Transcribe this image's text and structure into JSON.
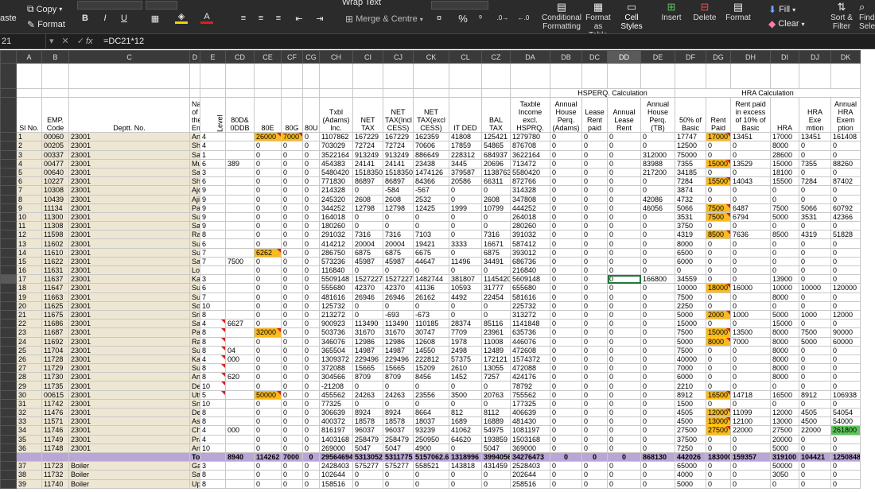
{
  "ribbon": {
    "paste": "aste",
    "copy": "Copy",
    "format_painter": "Format",
    "bold": "B",
    "italic": "I",
    "underline": "U",
    "font_color_letter": "A",
    "wrap_text": "Wrap Text",
    "merge_centre": "Merge & Centre",
    "percent": "%",
    "conditional_formatting": [
      "Conditional",
      "Formatting"
    ],
    "format_as_table": [
      "Format",
      "as Table"
    ],
    "cell_styles": [
      "Cell",
      "Styles"
    ],
    "insert": "Insert",
    "delete": "Delete",
    "format": "Format",
    "fill": "Fill",
    "clear": "Clear",
    "sort_filter": [
      "Sort &",
      "Filter"
    ],
    "find_select": [
      "Find",
      "Sele"
    ],
    "accent_colors": {
      "highlight": "#f0d200",
      "font": "#e81919"
    }
  },
  "formula_bar": {
    "name_box": "21",
    "fx": "fx",
    "formula": "=DC21*12"
  },
  "columns": [
    "A",
    "B",
    "C",
    "D",
    "E",
    "CD",
    "CE",
    "CF",
    "CG",
    "CH",
    "CI",
    "CJ",
    "CK",
    "CL",
    "CZ",
    "DA",
    "DB",
    "DC",
    "DD",
    "DE",
    "DF",
    "DG",
    "DH",
    "DI",
    "DJ",
    "DK"
  ],
  "selected_column": "DD",
  "group_headers": {
    "hsperq": "HSPERQ. Calculation",
    "hra": "HRA Calculation"
  },
  "headers": [
    "Sl No.",
    "EMP. Code",
    "Deptt. No.",
    "Name of the Employee",
    "Level",
    "80D& 0DDB",
    "80E",
    "80G",
    "80U",
    "Txbl (Adams) Inc.",
    "NET TAX",
    "NET TAX(Incl CESS)",
    "NET TAX(excl CESS)",
    "IT DED",
    "BAL TAX",
    "Taxble Income excl. HSPRQ.",
    "Annual House Perq. (Adams)",
    "Lease Rent paid",
    "Annual Lease Rent",
    "Annual House Perq. (TB)",
    "50% of Basic",
    "Rent Paid",
    "Rent paid in excess of 10% of Basic",
    "HRA",
    "HRA Exe mtion",
    "Annual HRA Exem ption"
  ],
  "rows": [
    [
      "1",
      "00060",
      "23001",
      "Anjan Kumar Chowdhury",
      "4",
      "",
      "26000",
      "7000",
      "0",
      "1107862",
      "167229",
      "167229",
      "162359",
      "41808",
      "125421",
      "1279780",
      "0",
      "0",
      "0",
      "0",
      "17747",
      "17000",
      "13451",
      "17000",
      "13451",
      "161408"
    ],
    [
      "2",
      "00205",
      "23001",
      "Shyamal Kumar Patra",
      "4",
      "",
      "0",
      "0",
      "0",
      "703029",
      "72724",
      "72724",
      "70606",
      "17859",
      "54865",
      "876708",
      "0",
      "0",
      "0",
      "0",
      "12500",
      "0",
      "0",
      "8000",
      "0",
      "0"
    ],
    [
      "3",
      "00337",
      "23001",
      "Sabyasachi Mishra",
      "1",
      "",
      "0",
      "0",
      "0",
      "3522164",
      "913249",
      "913249",
      "886649",
      "228312",
      "684937",
      "3622164",
      "0",
      "0",
      "0",
      "312000",
      "75000",
      "0",
      "0",
      "28600",
      "0",
      "0"
    ],
    [
      "4",
      "00477",
      "23001",
      "Mukunda Chandra Mohanta",
      "6",
      "389",
      "0",
      "0",
      "0",
      "454383",
      "24141",
      "24141",
      "23438",
      "3445",
      "20696",
      "713472",
      "0",
      "0",
      "0",
      "83988",
      "7355",
      "15000",
      "13529",
      "15000",
      "7355",
      "88260"
    ],
    [
      "5",
      "00640",
      "23001",
      "Satyabrata Misra",
      "3",
      "",
      "0",
      "0",
      "0",
      "5480420",
      "1518350",
      "1518350",
      "1474126",
      "379587",
      "1138763",
      "5580420",
      "0",
      "0",
      "0",
      "217200",
      "34185",
      "0",
      "0",
      "18100",
      "0",
      "0"
    ],
    [
      "6",
      "10227",
      "23001",
      "Shankar Prasad Kurmy",
      "6",
      "",
      "0",
      "0",
      "0",
      "771830",
      "86897",
      "86897",
      "84366",
      "20586",
      "66311",
      "872766",
      "0",
      "0",
      "0",
      "0",
      "7284",
      "15500",
      "14043",
      "15500",
      "7284",
      "87402"
    ],
    [
      "7",
      "10308",
      "23001",
      "Ajoy Kumar Dutta",
      "9",
      "",
      "0",
      "0",
      "0",
      "214328",
      "0",
      "-584",
      "-567",
      "0",
      "0",
      "314328",
      "0",
      "0",
      "0",
      "0",
      "3874",
      "0",
      "0",
      "0",
      "0",
      "0"
    ],
    [
      "8",
      "10439",
      "23001",
      "Ajit Kumar Basak",
      "9",
      "",
      "0",
      "0",
      "0",
      "245320",
      "2608",
      "2608",
      "2532",
      "0",
      "2608",
      "347808",
      "0",
      "0",
      "0",
      "42086",
      "4732",
      "0",
      "0",
      "0",
      "0",
      "0"
    ],
    [
      "9",
      "11134",
      "23001",
      "Partha Sanyal",
      "9",
      "",
      "0",
      "0",
      "0",
      "344252",
      "12798",
      "12798",
      "12425",
      "1999",
      "10799",
      "444252",
      "0",
      "0",
      "0",
      "46056",
      "5066",
      "7500",
      "6487",
      "7500",
      "5066",
      "60792"
    ],
    [
      "10",
      "11300",
      "23001",
      "Subrata Paul",
      "9",
      "",
      "0",
      "0",
      "0",
      "164018",
      "0",
      "0",
      "0",
      "0",
      "0",
      "264018",
      "0",
      "0",
      "0",
      "0",
      "3531",
      "7500",
      "6794",
      "5000",
      "3531",
      "42366"
    ],
    [
      "11",
      "11308",
      "23001",
      "Santanu Sengupta",
      "9",
      "",
      "0",
      "0",
      "0",
      "180260",
      "0",
      "0",
      "0",
      "0",
      "0",
      "280260",
      "0",
      "0",
      "0",
      "0",
      "3750",
      "0",
      "0",
      "0",
      "0",
      "0"
    ],
    [
      "12",
      "11598",
      "23001",
      "Rajani Kant Mishra",
      "8",
      "",
      "0",
      "0",
      "0",
      "291032",
      "7316",
      "7316",
      "7103",
      "0",
      "7316",
      "391032",
      "0",
      "0",
      "0",
      "0",
      "4319",
      "8500",
      "7636",
      "8500",
      "4319",
      "51828"
    ],
    [
      "13",
      "11602",
      "23001",
      "Surjit Singh",
      "6",
      "",
      "0",
      "0",
      "0",
      "414212",
      "20004",
      "20004",
      "19421",
      "3333",
      "16671",
      "587412",
      "0",
      "0",
      "0",
      "0",
      "8000",
      "0",
      "0",
      "0",
      "0",
      "0"
    ],
    [
      "14",
      "11610",
      "23001",
      "Sudip Kumar Das",
      "7",
      "",
      "6262",
      "0",
      "0",
      "286750",
      "6875",
      "6875",
      "6675",
      "0",
      "6875",
      "393012",
      "0",
      "0",
      "0",
      "0",
      "6500",
      "0",
      "0",
      "0",
      "0",
      "0"
    ],
    [
      "15",
      "11622",
      "23001",
      "Sanjoy Bose",
      "7",
      "7500",
      "0",
      "0",
      "0",
      "573236",
      "45987",
      "45987",
      "44647",
      "11496",
      "34491",
      "686736",
      "0",
      "0",
      "0",
      "0",
      "6000",
      "0",
      "0",
      "0",
      "0",
      "0"
    ],
    [
      "16",
      "11631",
      "23001",
      "Lopamudra Roy",
      "",
      "",
      "0",
      "0",
      "0",
      "116840",
      "0",
      "0",
      "0",
      "0",
      "0",
      "216840",
      "0",
      "0",
      "0",
      "0",
      "0",
      "0",
      "0",
      "0",
      "0",
      "0"
    ],
    [
      "17",
      "11637",
      "23001",
      "Kailash Kumar Agrawal",
      "3",
      "",
      "0",
      "0",
      "0",
      "5509148",
      "1527227",
      "1527227",
      "1482744",
      "381807",
      "1145420",
      "5609148",
      "0",
      "0",
      "0",
      "166800",
      "34559",
      "0",
      "0",
      "13900",
      "0",
      "0"
    ],
    [
      "18",
      "11647",
      "23001",
      "Sudha Agarwal",
      "6",
      "",
      "0",
      "0",
      "0",
      "555680",
      "42370",
      "42370",
      "41136",
      "10593",
      "31777",
      "655680",
      "0",
      "0",
      "0",
      "0",
      "10000",
      "18000",
      "16000",
      "10000",
      "10000",
      "120000"
    ],
    [
      "19",
      "11663",
      "23001",
      "Sudip Paul",
      "7",
      "",
      "0",
      "0",
      "0",
      "481616",
      "26946",
      "26946",
      "26162",
      "4492",
      "22454",
      "581616",
      "0",
      "0",
      "0",
      "0",
      "7500",
      "0",
      "0",
      "8000",
      "0",
      "0"
    ],
    [
      "20",
      "11625",
      "23001",
      "Somnath Poddar",
      "10",
      "",
      "0",
      "0",
      "0",
      "125732",
      "0",
      "0",
      "0",
      "0",
      "0",
      "225732",
      "0",
      "0",
      "0",
      "0",
      "2250",
      "0",
      "0",
      "0",
      "0",
      "0"
    ],
    [
      "21",
      "11675",
      "23001",
      "Srikrishna Pradhan",
      "8",
      "",
      "0",
      "0",
      "0",
      "213272",
      "0",
      "-693",
      "-673",
      "0",
      "0",
      "313272",
      "0",
      "0",
      "0",
      "0",
      "5000",
      "2000",
      "1000",
      "5000",
      "1000",
      "12000"
    ],
    [
      "22",
      "11686",
      "23001",
      "Sajal Ghosh",
      "4",
      "6627",
      "0",
      "0",
      "0",
      "900923",
      "113490",
      "113490",
      "110185",
      "28374",
      "85116",
      "1141848",
      "0",
      "0",
      "0",
      "0",
      "15000",
      "0",
      "0",
      "15000",
      "0",
      "0"
    ],
    [
      "23",
      "11687",
      "23001",
      "Palash Mukerjee",
      "8",
      "",
      "32000",
      "0",
      "0",
      "503736",
      "31670",
      "31670",
      "30747",
      "7709",
      "23961",
      "635736",
      "0",
      "0",
      "0",
      "0",
      "7500",
      "15000",
      "13500",
      "8000",
      "7500",
      "90000"
    ],
    [
      "24",
      "11692",
      "23001",
      "Rajesh Kumar Singh",
      "8",
      "",
      "0",
      "0",
      "0",
      "346076",
      "12986",
      "12986",
      "12608",
      "1978",
      "11008",
      "446076",
      "0",
      "0",
      "0",
      "0",
      "5000",
      "8000",
      "7000",
      "8000",
      "5000",
      "60000"
    ],
    [
      "25",
      "11704",
      "23001",
      "Subrata Roy",
      "8",
      "04",
      "0",
      "0",
      "0",
      "365504",
      "14987",
      "14987",
      "14550",
      "2498",
      "12489",
      "472608",
      "0",
      "0",
      "0",
      "0",
      "7500",
      "0",
      "0",
      "8000",
      "0",
      "0"
    ],
    [
      "26",
      "11728",
      "23001",
      "Kaushik Sengupta",
      "4",
      "000",
      "0",
      "0",
      "0",
      "1309372",
      "229496",
      "229496",
      "222812",
      "57375",
      "172121",
      "1574372",
      "0",
      "0",
      "0",
      "0",
      "40000",
      "0",
      "0",
      "8000",
      "0",
      "0"
    ],
    [
      "27",
      "11729",
      "23001",
      "Supti Datta",
      "8",
      "",
      "0",
      "0",
      "0",
      "372088",
      "15665",
      "15665",
      "15209",
      "2610",
      "13055",
      "472088",
      "0",
      "0",
      "0",
      "0",
      "7000",
      "0",
      "0",
      "8000",
      "0",
      "0"
    ],
    [
      "28",
      "11730",
      "23001",
      "Anil Kumar Murarka",
      "8",
      "620",
      "0",
      "0",
      "0",
      "304566",
      "8709",
      "8709",
      "8456",
      "1452",
      "7257",
      "424176",
      "0",
      "0",
      "0",
      "0",
      "6000",
      "0",
      "0",
      "8000",
      "0",
      "0"
    ],
    [
      "29",
      "11735",
      "23001",
      "Debojyoti Poddar",
      "10",
      "",
      "0",
      "0",
      "0",
      "-21208",
      "0",
      "0",
      "0",
      "0",
      "0",
      "78792",
      "0",
      "0",
      "0",
      "0",
      "2210",
      "0",
      "0",
      "0",
      "0",
      "0"
    ],
    [
      "30",
      "00615",
      "23001",
      "Uttam Kumar Bhol",
      "5",
      "",
      "50000",
      "0",
      "0",
      "455562",
      "24263",
      "24263",
      "23556",
      "3500",
      "20763",
      "755562",
      "0",
      "0",
      "0",
      "0",
      "8912",
      "16500",
      "14718",
      "16500",
      "8912",
      "106938"
    ],
    [
      "31",
      "11742",
      "23001",
      "Sneha Basu",
      "10",
      "",
      "0",
      "0",
      "0",
      "77325",
      "0",
      "0",
      "0",
      "0",
      "0",
      "177325",
      "0",
      "0",
      "0",
      "0",
      "1500",
      "0",
      "0",
      "0",
      "0",
      "0"
    ],
    [
      "32",
      "11476",
      "23001",
      "Debasis Ojha",
      "8",
      "",
      "0",
      "0",
      "0",
      "306639",
      "8924",
      "8924",
      "8664",
      "812",
      "8112",
      "406639",
      "0",
      "0",
      "0",
      "0",
      "4505",
      "12000",
      "11099",
      "12000",
      "4505",
      "54054"
    ],
    [
      "33",
      "11571",
      "23001",
      "Asim Tirkey",
      "8",
      "",
      "0",
      "0",
      "0",
      "400372",
      "18578",
      "18578",
      "18037",
      "1689",
      "16889",
      "481430",
      "0",
      "0",
      "0",
      "0",
      "4500",
      "13000",
      "12100",
      "13000",
      "4500",
      "54000"
    ],
    [
      "34",
      "11746",
      "23001",
      "Chittaranjan Chakra",
      "4",
      "000",
      "0",
      "0",
      "0",
      "816197",
      "96037",
      "96037",
      "93239",
      "41062",
      "54975",
      "1081197",
      "0",
      "0",
      "0",
      "0",
      "27500",
      "27500",
      "22000",
      "27500",
      "22000",
      "261800"
    ],
    [
      "35",
      "11749",
      "23001",
      "Prasanta Roy",
      "4",
      "",
      "0",
      "0",
      "0",
      "1403168",
      "258479",
      "258479",
      "250950",
      "64620",
      "193859",
      "1503168",
      "0",
      "0",
      "0",
      "0",
      "37500",
      "0",
      "0",
      "20000",
      "0",
      "0"
    ],
    [
      "36",
      "11748",
      "23001",
      "Ankush Das",
      "10",
      "",
      "0",
      "0",
      "0",
      "269000",
      "5047",
      "5047",
      "4900",
      "0",
      "5047",
      "369000",
      "0",
      "0",
      "0",
      "0",
      "7250",
      "0",
      "0",
      "5000",
      "0",
      "0"
    ]
  ],
  "total": {
    "label": "Total",
    "values": [
      "8940",
      "114262",
      "7000",
      "0",
      "29564694",
      "5313052",
      "5311775",
      "5157062.6",
      "1318996",
      "3994056",
      "34276473",
      "0",
      "0",
      "0",
      "868130",
      "442026",
      "183000",
      "159357",
      "319100",
      "104421",
      "1250848"
    ]
  },
  "after_rows": [
    [
      "37",
      "11723",
      "Boiler",
      "Gajanan Shankar Despande",
      "3",
      "",
      "0",
      "0",
      "0",
      "2428403",
      "575277",
      "575277",
      "558521",
      "143818",
      "431459",
      "2528403",
      "0",
      "0",
      "0",
      "0",
      "65000",
      "0",
      "0",
      "50000",
      "0",
      "0"
    ],
    [
      "38",
      "11732",
      "Boiler",
      "Sandeep Kumar Padhiary",
      "8",
      "",
      "0",
      "0",
      "0",
      "102644",
      "0",
      "0",
      "0",
      "0",
      "0",
      "202644",
      "0",
      "0",
      "0",
      "0",
      "4000",
      "0",
      "0",
      "3050",
      "0",
      "0"
    ],
    [
      "39",
      "11740",
      "Boiler",
      "Upayan Bhol",
      "8",
      "",
      "0",
      "0",
      "0",
      "158516",
      "0",
      "0",
      "0",
      "0",
      "0",
      "258516",
      "0",
      "0",
      "0",
      "0",
      "5000",
      "0",
      "0",
      "0",
      "0",
      "0"
    ]
  ],
  "highlights": {
    "orange": [
      [
        1,
        6
      ],
      [
        1,
        7
      ],
      [
        1,
        21
      ],
      [
        4,
        21
      ],
      [
        6,
        21
      ],
      [
        9,
        21
      ],
      [
        10,
        21
      ],
      [
        12,
        21
      ],
      [
        14,
        6
      ],
      [
        18,
        21
      ],
      [
        21,
        21
      ],
      [
        23,
        6
      ],
      [
        23,
        21
      ],
      [
        24,
        21
      ],
      [
        30,
        6
      ],
      [
        30,
        21
      ],
      [
        32,
        21
      ],
      [
        33,
        21
      ],
      [
        34,
        21
      ]
    ],
    "green": [
      [
        34,
        25
      ]
    ]
  },
  "selected_cell": {
    "row": 17,
    "col": 18
  }
}
